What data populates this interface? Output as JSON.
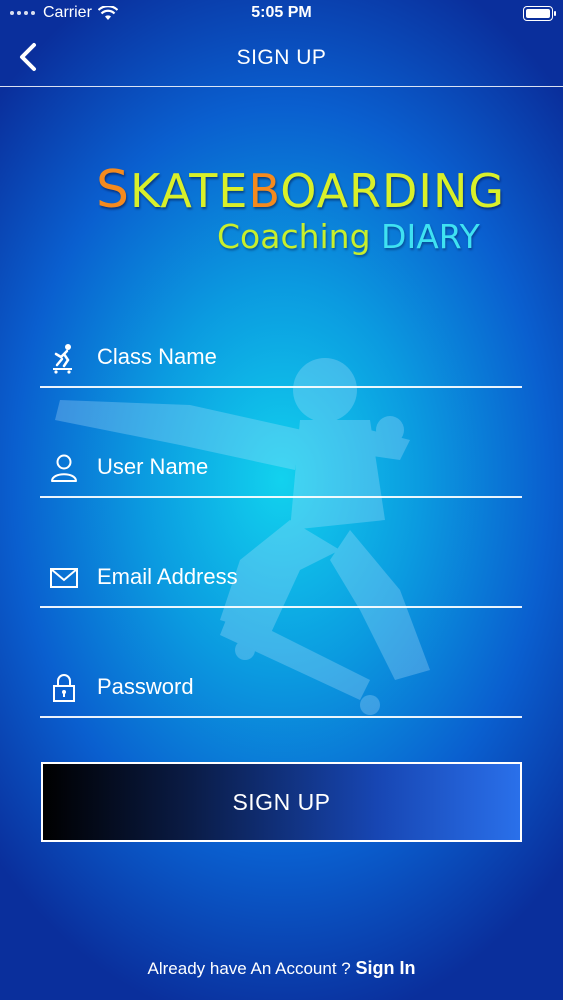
{
  "status_bar": {
    "carrier": "Carrier",
    "time": "5:05 PM"
  },
  "navbar": {
    "title": "SIGN UP",
    "back_icon": "chevron-left-icon"
  },
  "logo": {
    "main_first": "S",
    "main_a": "KATE",
    "main_o": "B",
    "main_b": "OARDING",
    "sub_a": "Coaching ",
    "sub_b": "DIARY"
  },
  "form": {
    "fields": [
      {
        "placeholder": "Class Name",
        "icon": "skater-icon"
      },
      {
        "placeholder": "User Name",
        "icon": "user-icon"
      },
      {
        "placeholder": "Email Address",
        "icon": "mail-icon"
      },
      {
        "placeholder": "Password",
        "icon": "lock-icon"
      }
    ],
    "submit_label": "SIGN UP"
  },
  "footer": {
    "prompt": "Already have An Account ? ",
    "link": "Sign In"
  },
  "colors": {
    "background": "#0a5fcf",
    "logo_yellow": "#d9f02a",
    "logo_orange": "#f58a1e",
    "logo_cyan": "#3fe2f2"
  }
}
